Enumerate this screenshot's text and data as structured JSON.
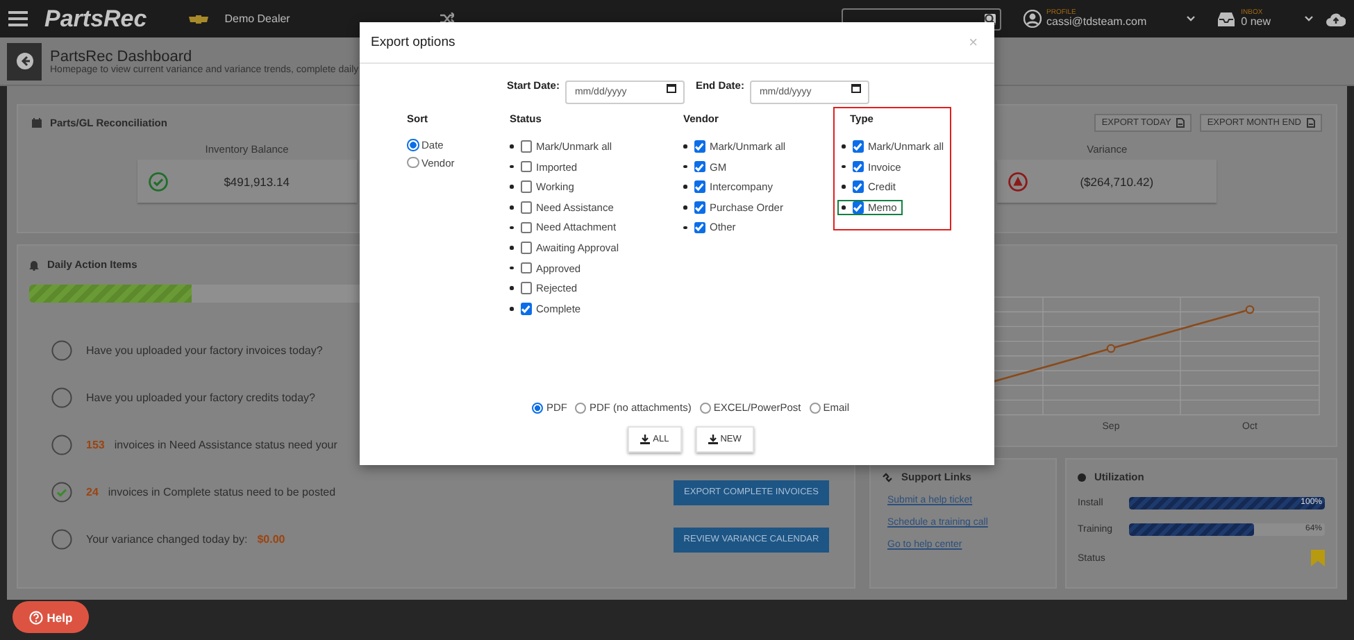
{
  "top_bar": {
    "logo": "PartsRec",
    "dealer": "Demo Dealer",
    "profile": {
      "label": "PROFILE",
      "email": "cassi@tdsteam.com"
    },
    "inbox": {
      "label": "INBOX",
      "count": "0 new"
    }
  },
  "header": {
    "title": "PartsRec Dashboard",
    "subtitle": "Homepage to view current variance and variance trends, complete daily"
  },
  "reconciliation": {
    "title": "Parts/GL Reconciliation",
    "buttons": [
      "EXPORT TODAY",
      "EXPORT MONTH END"
    ],
    "cards": [
      {
        "label": "Inventory Balance",
        "value": "$491,913.14",
        "kind": "ok"
      },
      {
        "label": "Variance",
        "value": "($264,710.42)",
        "kind": "alert"
      }
    ]
  },
  "daily": {
    "title": "Daily Action Items",
    "progress": {
      "level": 0.2
    },
    "items": [
      {
        "done": false,
        "text": "Have you uploaded your factory invoices today?"
      },
      {
        "done": false,
        "text": "Have you uploaded your factory credits today?"
      },
      {
        "done": false,
        "count": "153",
        "text": "invoices in Need Assistance status need your"
      },
      {
        "done": true,
        "count": "24",
        "text": "invoices in Complete status need to be posted",
        "button": "EXPORT COMPLETE INVOICES"
      },
      {
        "done": false,
        "text": "Your variance changed today by:",
        "amount": "$0.00",
        "button": "REVIEW VARIANCE CALENDAR"
      }
    ]
  },
  "chart": {
    "x_labels": [
      "Sep",
      "Oct"
    ]
  },
  "support": {
    "title": "Support Links",
    "links": [
      "Submit a help ticket",
      "Schedule a training call",
      "Go to help center"
    ]
  },
  "utilization": {
    "title": "Utilization",
    "bars": [
      {
        "label": "Install",
        "level": 1,
        "reading": "100%"
      },
      {
        "label": "Training",
        "level": 0.64,
        "reading": "64%"
      }
    ],
    "status_label": "Status"
  },
  "help": "Help",
  "modal": {
    "title": "Export options",
    "close": "×",
    "start_label": "Start Date:",
    "end_label": "End Date:",
    "start_placeholder": "mm/dd/yyyy",
    "end_placeholder": "mm/dd/yyyy",
    "sort": {
      "title": "Sort",
      "options": [
        {
          "label": "Date",
          "selected": true
        },
        {
          "label": "Vendor",
          "selected": false
        }
      ]
    },
    "groups": [
      {
        "title": "Status",
        "highlighted": false,
        "items": [
          {
            "label": "Mark/Unmark all",
            "checked": false,
            "highlighted": false
          },
          {
            "label": "Imported",
            "checked": false,
            "highlighted": false
          },
          {
            "label": "Working",
            "checked": false,
            "highlighted": false
          },
          {
            "label": "Need Assistance",
            "checked": false,
            "highlighted": false
          },
          {
            "label": "Need Attachment",
            "checked": false,
            "highlighted": false
          },
          {
            "label": "Awaiting Approval",
            "checked": false,
            "highlighted": false
          },
          {
            "label": "Approved",
            "checked": false,
            "highlighted": false
          },
          {
            "label": "Rejected",
            "checked": false,
            "highlighted": false
          },
          {
            "label": "Complete",
            "checked": true,
            "highlighted": false
          }
        ]
      },
      {
        "title": "Vendor",
        "highlighted": false,
        "items": [
          {
            "label": "Mark/Unmark all",
            "checked": true,
            "highlighted": false
          },
          {
            "label": "GM",
            "checked": true,
            "highlighted": false
          },
          {
            "label": "Intercompany",
            "checked": true,
            "highlighted": false
          },
          {
            "label": "Purchase Order",
            "checked": true,
            "highlighted": false
          },
          {
            "label": "Other",
            "checked": true,
            "highlighted": false
          }
        ]
      },
      {
        "title": "Type",
        "highlighted": true,
        "items": [
          {
            "label": "Mark/Unmark all",
            "checked": true,
            "highlighted": false
          },
          {
            "label": "Invoice",
            "checked": true,
            "highlighted": false
          },
          {
            "label": "Credit",
            "checked": true,
            "highlighted": false
          },
          {
            "label": "Memo",
            "checked": true,
            "highlighted": true
          }
        ]
      }
    ],
    "formats": [
      {
        "label": "PDF",
        "selected": true
      },
      {
        "label": "PDF (no attachments)",
        "selected": false
      },
      {
        "label": "EXCEL/PowerPost",
        "selected": false
      },
      {
        "label": "Email",
        "selected": false
      }
    ],
    "buttons": [
      "ALL",
      "NEW"
    ]
  }
}
